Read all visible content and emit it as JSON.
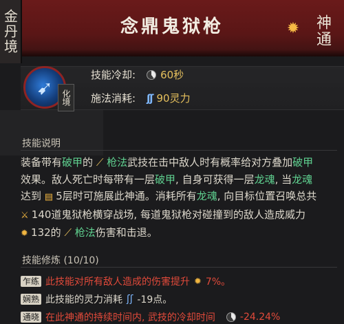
{
  "realm_label": "金丹境",
  "title": "念鼎鬼狱枪",
  "category_label": "神通",
  "icon_names": {
    "burst": "burst-icon",
    "skill": "spear-skill-icon",
    "clock": "cooldown-clock-icon",
    "mana": "mana-swirl-icon"
  },
  "badge_label": "化境",
  "stats": [
    {
      "label": "技能冷却:",
      "value": "60秒"
    },
    {
      "label": "施法消耗:",
      "value": "90灵力"
    }
  ],
  "description": {
    "title": "技能说明",
    "parts": [
      {
        "t": "装备带有",
        "c": "n"
      },
      {
        "t": "破甲",
        "c": "g"
      },
      {
        "t": "的 ",
        "c": "n"
      },
      {
        "t": "枪法",
        "c": "g"
      },
      {
        "t": "武技在击中敌人时有概率给对方叠加",
        "c": "n"
      },
      {
        "t": "破甲",
        "c": "g"
      },
      {
        "t": "效果。敌人死亡时每带有一层",
        "c": "n"
      },
      {
        "t": "破甲",
        "c": "g"
      },
      {
        "t": ", 自身可获得一层",
        "c": "n"
      },
      {
        "t": "龙魂",
        "c": "g"
      },
      {
        "t": ", 当",
        "c": "n"
      },
      {
        "t": "龙魂",
        "c": "g"
      },
      {
        "t": "达到 ",
        "c": "n"
      },
      {
        "t": "5层时可施展此神通。消耗所有",
        "c": "n"
      },
      {
        "t": "龙魂",
        "c": "g"
      },
      {
        "t": ", 向目标位置召唤总共 ",
        "c": "n"
      },
      {
        "t": "140道鬼狱枪横穿战场, 每道鬼狱枪对碰撞到的敌人造成威力 ",
        "c": "n"
      },
      {
        "t": "132的 ",
        "c": "n"
      },
      {
        "t": "枪法",
        "c": "g"
      },
      {
        "t": "伤害和击退。",
        "c": "n"
      }
    ]
  },
  "training": {
    "title": "技能修炼 (10/10)",
    "rows": [
      {
        "tag": "乍练",
        "text": "此技能对所有敌人造成的伤害提升",
        "value": "7%。"
      },
      {
        "tag": "娴熟",
        "text": "此技能的灵力消耗",
        "value": "-19点。"
      },
      {
        "tag": "通晓",
        "text": "在此神通的持续时间内, 武技的冷却时间",
        "value": "-24.24%"
      }
    ]
  },
  "colors": {
    "header": "#5a1616",
    "accent_green": "#5fd08f",
    "accent_gold": "#e6c05d",
    "accent_red": "#e24a3a",
    "mana_blue": "#7fb8ff"
  }
}
